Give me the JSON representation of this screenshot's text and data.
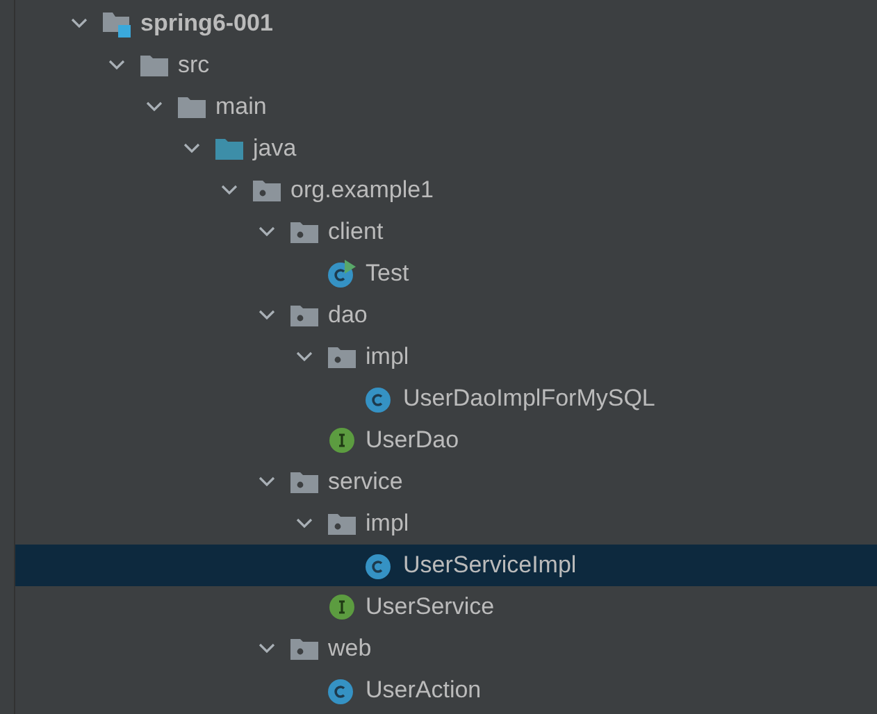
{
  "tree": [
    {
      "kind": "module",
      "label": "spring6-001",
      "expanded": true,
      "selected": false,
      "children": [
        {
          "kind": "folder",
          "label": "src",
          "expanded": true,
          "selected": false,
          "children": [
            {
              "kind": "folder",
              "label": "main",
              "expanded": true,
              "selected": false,
              "children": [
                {
                  "kind": "source-folder",
                  "label": "java",
                  "expanded": true,
                  "selected": false,
                  "children": [
                    {
                      "kind": "package",
                      "label": "org.example1",
                      "expanded": true,
                      "selected": false,
                      "children": [
                        {
                          "kind": "package",
                          "label": "client",
                          "expanded": true,
                          "selected": false,
                          "children": [
                            {
                              "kind": "runnable-class",
                              "label": "Test",
                              "selected": false
                            }
                          ]
                        },
                        {
                          "kind": "package",
                          "label": "dao",
                          "expanded": true,
                          "selected": false,
                          "children": [
                            {
                              "kind": "package",
                              "label": "impl",
                              "expanded": true,
                              "selected": false,
                              "children": [
                                {
                                  "kind": "class",
                                  "label": "UserDaoImplForMySQL",
                                  "selected": false
                                }
                              ]
                            },
                            {
                              "kind": "interface",
                              "label": "UserDao",
                              "selected": false
                            }
                          ]
                        },
                        {
                          "kind": "package",
                          "label": "service",
                          "expanded": true,
                          "selected": false,
                          "children": [
                            {
                              "kind": "package",
                              "label": "impl",
                              "expanded": true,
                              "selected": false,
                              "children": [
                                {
                                  "kind": "class",
                                  "label": "UserServiceImpl",
                                  "selected": true
                                }
                              ]
                            },
                            {
                              "kind": "interface",
                              "label": "UserService",
                              "selected": false
                            }
                          ]
                        },
                        {
                          "kind": "package",
                          "label": "web",
                          "expanded": true,
                          "selected": false,
                          "children": [
                            {
                              "kind": "class",
                              "label": "UserAction",
                              "selected": false
                            }
                          ]
                        }
                      ]
                    }
                  ]
                }
              ]
            }
          ]
        }
      ]
    }
  ]
}
